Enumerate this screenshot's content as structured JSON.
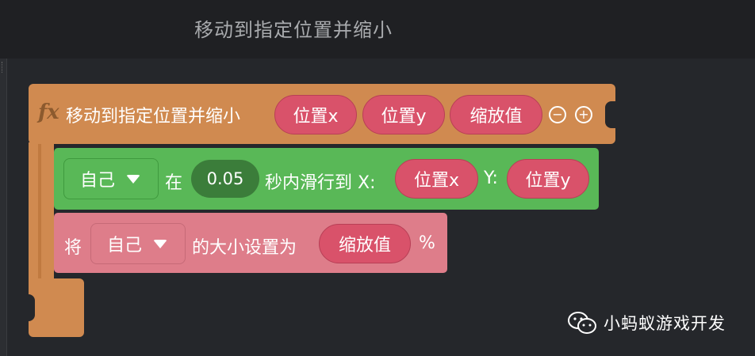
{
  "header": {
    "title": "移动到指定位置并缩小"
  },
  "function_block": {
    "fx_label": "fx",
    "name": "移动到指定位置并缩小",
    "params": [
      "位置x",
      "位置y",
      "缩放值"
    ],
    "remove_param_label": "−",
    "add_param_label": "+"
  },
  "glide_block": {
    "target": "自己",
    "in_label": "在",
    "seconds": "0.05",
    "text_mid": "秒内滑行到 X:",
    "x_value": "位置x",
    "y_label": "Y:",
    "y_value": "位置y"
  },
  "size_block": {
    "prefix": "将",
    "target": "自己",
    "text_mid": "的大小设置为",
    "value": "缩放值",
    "suffix": "%"
  },
  "watermark": {
    "label": "小蚂蚁游戏开发"
  },
  "colors": {
    "function": "#d08a50",
    "motion": "#59b857",
    "looks": "#de7d8a",
    "param": "#d9526a"
  }
}
